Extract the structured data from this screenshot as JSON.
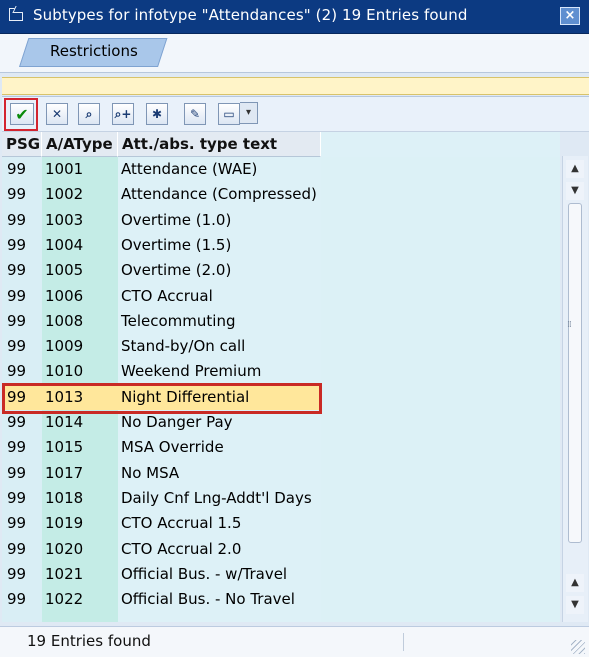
{
  "window": {
    "title": "Subtypes for infotype \"Attendances\" (2)   19 Entries found",
    "close_label": "×"
  },
  "tabs": [
    {
      "label": "Restrictions"
    }
  ],
  "toolbar": {
    "buttons": [
      {
        "icon": "checkmark-icon",
        "glyph": "✔"
      },
      {
        "icon": "cancel-icon",
        "glyph": "✕"
      },
      {
        "icon": "find-icon",
        "glyph": "⌕"
      },
      {
        "icon": "find-next-icon",
        "glyph": "⌕+"
      },
      {
        "icon": "settings-icon",
        "glyph": "✱"
      },
      {
        "icon": "personalize-icon",
        "glyph": "✎"
      },
      {
        "icon": "print-icon",
        "glyph": "▭"
      }
    ],
    "dropdown_glyph": "▾"
  },
  "table": {
    "headers": [
      "PSG",
      "A/AType",
      "Att./abs. type text"
    ],
    "rows": [
      [
        "99",
        "1001",
        "Attendance (WAE)"
      ],
      [
        "99",
        "1002",
        "Attendance (Compressed)"
      ],
      [
        "99",
        "1003",
        "Overtime (1.0)"
      ],
      [
        "99",
        "1004",
        "Overtime (1.5)"
      ],
      [
        "99",
        "1005",
        "Overtime (2.0)"
      ],
      [
        "99",
        "1006",
        "CTO Accrual"
      ],
      [
        "99",
        "1008",
        "Telecommuting"
      ],
      [
        "99",
        "1009",
        "Stand-by/On call"
      ],
      [
        "99",
        "1010",
        "Weekend Premium"
      ],
      [
        "99",
        "1013",
        "Night Differential"
      ],
      [
        "99",
        "1014",
        "No Danger Pay"
      ],
      [
        "99",
        "1015",
        "MSA Override"
      ],
      [
        "99",
        "1017",
        "No MSA"
      ],
      [
        "99",
        "1018",
        "Daily Cnf Lng-Addt'l Days"
      ],
      [
        "99",
        "1019",
        "CTO Accrual 1.5"
      ],
      [
        "99",
        "1020",
        "CTO Accrual 2.0"
      ],
      [
        "99",
        "1021",
        "Official Bus. - w/Travel"
      ],
      [
        "99",
        "1022",
        "Official Bus. - No Travel"
      ]
    ],
    "selected_row": 9
  },
  "scrollbar": {
    "up": "▲",
    "down": "▼",
    "grip": "⁞⁞"
  },
  "status": {
    "text": "19 Entries found"
  },
  "colors": {
    "titlebar": "#0c3a82",
    "selection": "#ffe79b",
    "highlight": "#d3242f"
  }
}
